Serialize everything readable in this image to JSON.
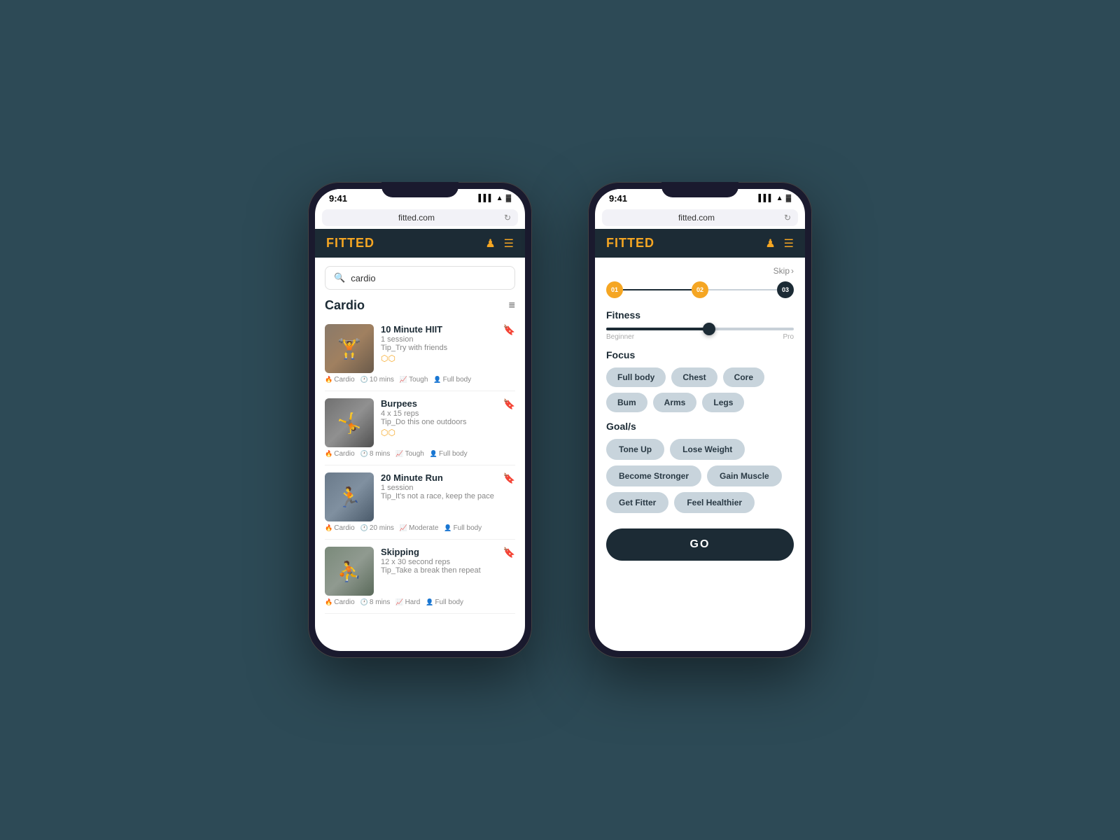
{
  "app": {
    "logo": "FITTED",
    "url": "fitted.com",
    "time": "9:41"
  },
  "phone1": {
    "search": {
      "placeholder": "cardio",
      "value": "cardio"
    },
    "list": {
      "title": "Cardio",
      "workouts": [
        {
          "title": "10 Minute HIIT",
          "sessions": "1 session",
          "tip": "Tip_Try with friends",
          "tags": [
            "Cardio",
            "10 mins",
            "Tough",
            "Full body"
          ],
          "imgClass": "workout-img-1",
          "imgChar": "🏋"
        },
        {
          "title": "Burpees",
          "sessions": "4 x 15 reps",
          "tip": "Tip_Do this one outdoors",
          "tags": [
            "Cardio",
            "8 mins",
            "Tough",
            "Full body"
          ],
          "imgClass": "workout-img-2",
          "imgChar": "🤸"
        },
        {
          "title": "20 Minute Run",
          "sessions": "1 session",
          "tip": "Tip_It's not a race, keep the pace",
          "tags": [
            "Cardio",
            "20 mins",
            "Moderate",
            "Full body"
          ],
          "imgClass": "workout-img-3",
          "imgChar": "🏃"
        },
        {
          "title": "Skipping",
          "sessions": "12 x 30 second reps",
          "tip": "Tip_Take a break then repeat",
          "tags": [
            "Cardio",
            "8 mins",
            "Hard",
            "Full body"
          ],
          "imgClass": "workout-img-4",
          "imgChar": "⛹"
        }
      ]
    }
  },
  "phone2": {
    "skip_label": "Skip",
    "steps": [
      "01",
      "02",
      "03"
    ],
    "fitness": {
      "label": "Fitness",
      "slider_value": 55,
      "label_left": "Beginner",
      "label_right": "Pro"
    },
    "focus": {
      "label": "Focus",
      "chips": [
        {
          "label": "Full body",
          "selected": false
        },
        {
          "label": "Chest",
          "selected": false
        },
        {
          "label": "Core",
          "selected": false
        },
        {
          "label": "Bum",
          "selected": false
        },
        {
          "label": "Arms",
          "selected": false
        },
        {
          "label": "Legs",
          "selected": false
        }
      ]
    },
    "goals": {
      "label": "Goal/s",
      "chips": [
        {
          "label": "Tone Up",
          "selected": false
        },
        {
          "label": "Lose Weight",
          "selected": false
        },
        {
          "label": "Become Stronger",
          "selected": false
        },
        {
          "label": "Gain Muscle",
          "selected": false
        },
        {
          "label": "Get Fitter",
          "selected": false
        },
        {
          "label": "Feel Healthier",
          "selected": false
        }
      ]
    },
    "go_label": "GO"
  },
  "icons": {
    "user": "♟",
    "menu": "☰",
    "search": "🔍",
    "filter": "⚙",
    "bookmark": "🔖",
    "dumbbell": "🔗",
    "fire": "🔥",
    "clock": "🕐",
    "trending": "📈",
    "person": "👤",
    "refresh": "↻",
    "chevron_right": "›"
  }
}
